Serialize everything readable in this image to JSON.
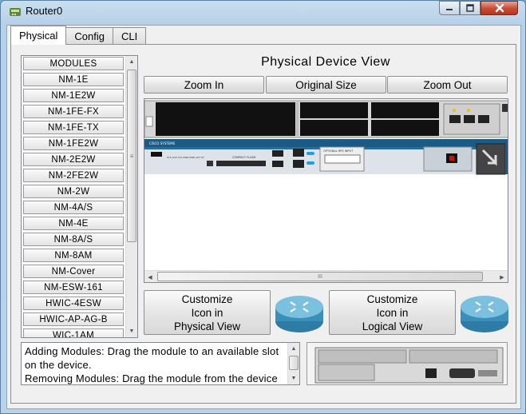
{
  "window": {
    "title": "Router0"
  },
  "tabs": [
    {
      "label": "Physical"
    },
    {
      "label": "Config"
    },
    {
      "label": "CLI"
    }
  ],
  "modules": {
    "items": [
      "MODULES",
      "NM-1E",
      "NM-1E2W",
      "NM-1FE-FX",
      "NM-1FE-TX",
      "NM-1FE2W",
      "NM-2E2W",
      "NM-2FE2W",
      "NM-2W",
      "NM-4A/S",
      "NM-4E",
      "NM-8A/S",
      "NM-8AM",
      "NM-Cover",
      "NM-ESW-161",
      "HWIC-4ESW",
      "HWIC-AP-AG-B",
      "WIC-1AM"
    ]
  },
  "device_view": {
    "title": "Physical Device View",
    "zoom_in": "Zoom In",
    "original_size": "Original Size",
    "zoom_out": "Zoom Out",
    "scroll_grip": "III",
    "brand": "CISCO SYSTEMS",
    "compact_flash": "COMPACT FLASH",
    "ps_input": "OPTIONAL RPS INPUT",
    "voltage": "100 - 240V~ 2A 50/60 Hz",
    "sys_labels": "SYS AUX SYS PWR PWR ACT CF",
    "slot_labels": "EGRESS ROUTER INTEGRATED TRIPLE",
    "port_leds": "0/0 0/1"
  },
  "customize": {
    "physical": "Customize\nIcon in\nPhysical View",
    "logical": "Customize\nIcon in\nLogical View"
  },
  "info": {
    "text": "Adding Modules: Drag the module to an available slot on the device.\nRemoving Modules: Drag the module from the device to the list."
  },
  "colors": {
    "device_blue": "#1c5a86",
    "router_icon": "#3a8fb8"
  }
}
